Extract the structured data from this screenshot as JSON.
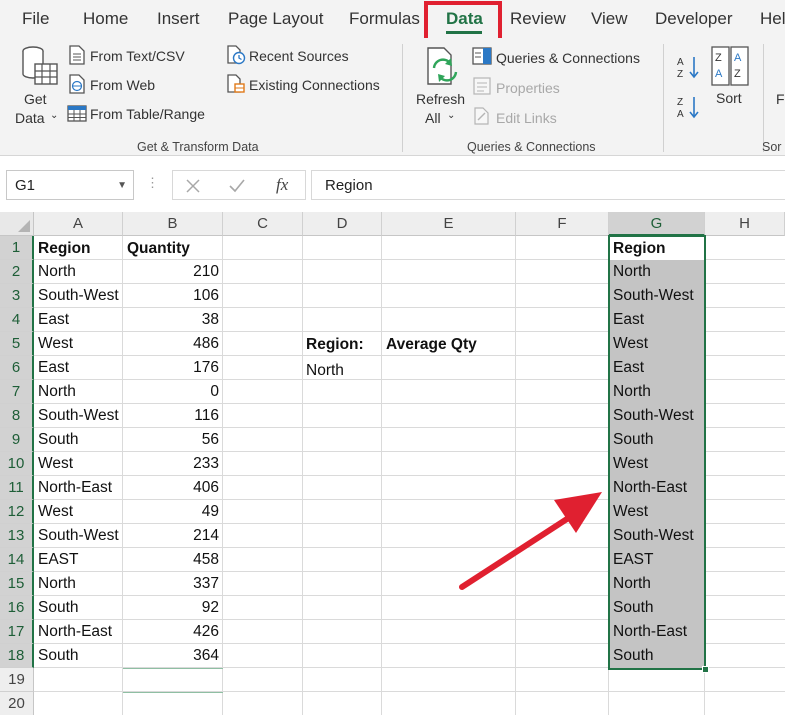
{
  "menu": {
    "tabs": [
      "File",
      "Home",
      "Insert",
      "Page Layout",
      "Formulas",
      "Data",
      "Review",
      "View",
      "Developer",
      "Hel"
    ]
  },
  "ribbon": {
    "get_data_line1": "Get",
    "get_data_line2": "Data",
    "from_text_csv": "From Text/CSV",
    "from_web": "From Web",
    "from_table_range": "From Table/Range",
    "recent_sources": "Recent Sources",
    "existing_connections": "Existing Connections",
    "group_get_transform": "Get & Transform Data",
    "refresh_line1": "Refresh",
    "refresh_line2": "All",
    "queries_connections": "Queries & Connections",
    "properties": "Properties",
    "edit_links": "Edit Links",
    "group_queries": "Queries & Connections",
    "sort": "Sort",
    "group_sort_partial": "Sor",
    "filter_partial": "F"
  },
  "formula_bar": {
    "name_box": "G1",
    "formula": "Region",
    "fx_symbol": "fx"
  },
  "grid": {
    "columns": [
      "A",
      "B",
      "C",
      "D",
      "E",
      "F",
      "G",
      "H"
    ],
    "rows": [
      "1",
      "2",
      "3",
      "4",
      "5",
      "6",
      "7",
      "8",
      "9",
      "10",
      "11",
      "12",
      "13",
      "14",
      "15",
      "16",
      "17",
      "18",
      "19",
      "20"
    ],
    "a_header": "Region",
    "b_header": "Quantity",
    "data_rows": [
      {
        "region": "North",
        "qty": "210"
      },
      {
        "region": "South-West",
        "qty": "106"
      },
      {
        "region": "East",
        "qty": "38"
      },
      {
        "region": "West",
        "qty": "486"
      },
      {
        "region": "East",
        "qty": "176"
      },
      {
        "region": "North",
        "qty": "0"
      },
      {
        "region": "South-West",
        "qty": "116"
      },
      {
        "region": "South",
        "qty": "56"
      },
      {
        "region": "West",
        "qty": "233"
      },
      {
        "region": "North-East",
        "qty": "406"
      },
      {
        "region": "West",
        "qty": "49"
      },
      {
        "region": "South-West",
        "qty": "214"
      },
      {
        "region": "EAST",
        "qty": "458"
      },
      {
        "region": "North",
        "qty": "337"
      },
      {
        "region": "South",
        "qty": "92"
      },
      {
        "region": "North-East",
        "qty": "426"
      },
      {
        "region": "South",
        "qty": "364"
      }
    ],
    "d5": "Region:",
    "e5": "Average Qty",
    "d6": "North",
    "g_header": "Region",
    "g_values": [
      "North",
      "South-West",
      "East",
      "West",
      "East",
      "North",
      "South-West",
      "South",
      "West",
      "North-East",
      "West",
      "South-West",
      "EAST",
      "North",
      "South",
      "North-East",
      "South"
    ]
  },
  "colors": {
    "excel_green": "#217346",
    "highlight_red": "#e02030",
    "selection_fill": "#c4c4c4"
  }
}
